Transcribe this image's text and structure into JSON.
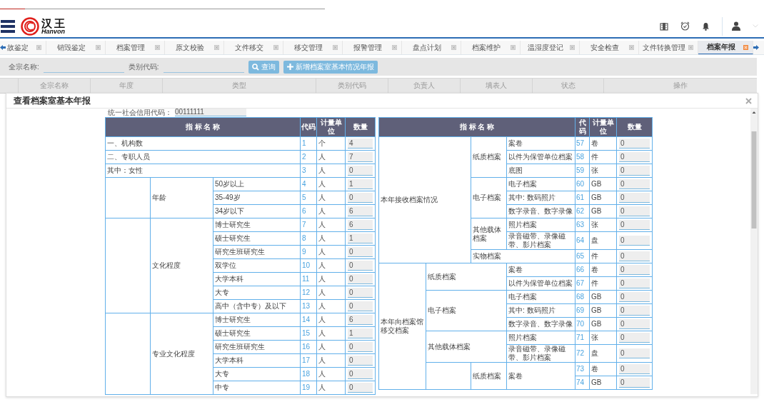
{
  "header": {
    "logo_cn": "汉王",
    "logo_en": "Hanvon"
  },
  "tabs": [
    {
      "label": "故鉴定",
      "selected": false
    },
    {
      "label": "销毁鉴定",
      "selected": false
    },
    {
      "label": "档案管理",
      "selected": false
    },
    {
      "label": "原文校验",
      "selected": false
    },
    {
      "label": "文件移交",
      "selected": false
    },
    {
      "label": "移交管理",
      "selected": false
    },
    {
      "label": "报警管理",
      "selected": false
    },
    {
      "label": "盘点计划",
      "selected": false
    },
    {
      "label": "档案维护",
      "selected": false
    },
    {
      "label": "温湿度登记",
      "selected": false
    },
    {
      "label": "安全检查",
      "selected": false
    },
    {
      "label": "文件转换管理",
      "selected": false
    },
    {
      "label": "档案年报",
      "selected": true
    }
  ],
  "search": {
    "fields": [
      {
        "label": "全宗名称:"
      },
      {
        "label": "类别代码:"
      }
    ],
    "buttons": [
      {
        "label": "查询",
        "kind": "search"
      },
      {
        "label": "新增档案室基本情况年报",
        "kind": "add"
      }
    ]
  },
  "grid": {
    "columns": [
      "全宗名称",
      "年度",
      "类型",
      "类别代码",
      "负责人",
      "填表人",
      "状态",
      "操作"
    ]
  },
  "dialog": {
    "title": "查看档案室基本年报",
    "credit_label": "统一社会信用代码：",
    "credit_value": "00111111",
    "tables": [
      {
        "headers": {
          "name": "指 标 名 称",
          "code": "代码",
          "unit": "计量单位",
          "quantity": "数量"
        },
        "rows": [
          {
            "label": "一、机构数",
            "code": "1",
            "unit": "个",
            "value": "4"
          },
          {
            "label": "二、专职人员",
            "code": "2",
            "unit": "人",
            "value": "7"
          },
          {
            "label": "其中：女性",
            "code": "3",
            "unit": "人",
            "value": "0"
          },
          {
            "children": [
              {
                "label": "年龄",
                "children": [
                  {
                    "label": "50岁以上",
                    "code": "4",
                    "unit": "人",
                    "value": "1"
                  },
                  {
                    "label": "35-49岁",
                    "code": "5",
                    "unit": "人",
                    "value": "0"
                  },
                  {
                    "label": "34岁以下",
                    "code": "6",
                    "unit": "人",
                    "value": "6"
                  }
                ]
              }
            ]
          },
          {
            "children": [
              {
                "label": "文化程度",
                "children": [
                  {
                    "label": "博士研究生",
                    "code": "7",
                    "unit": "人",
                    "value": "6"
                  },
                  {
                    "label": "硕士研究生",
                    "code": "8",
                    "unit": "人",
                    "value": "1"
                  },
                  {
                    "label": "研究生班研究生",
                    "code": "9",
                    "unit": "人",
                    "value": "0"
                  },
                  {
                    "label": "双学位",
                    "code": "10",
                    "unit": "人",
                    "value": "0"
                  },
                  {
                    "label": "大学本科",
                    "code": "11",
                    "unit": "人",
                    "value": "0"
                  },
                  {
                    "label": "大专",
                    "code": "12",
                    "unit": "人",
                    "value": "0"
                  },
                  {
                    "label": "高中（含中专）及以下",
                    "code": "13",
                    "unit": "人",
                    "value": "0"
                  }
                ]
              }
            ]
          },
          {
            "children": [
              {
                "label": "专业文化程度",
                "children": [
                  {
                    "label": "博士研究生",
                    "code": "14",
                    "unit": "人",
                    "value": "6"
                  },
                  {
                    "label": "硕士研究生",
                    "code": "15",
                    "unit": "人",
                    "value": "1"
                  },
                  {
                    "label": "研究生班研究生",
                    "code": "16",
                    "unit": "人",
                    "value": "0"
                  },
                  {
                    "label": "大学本科",
                    "code": "17",
                    "unit": "人",
                    "value": "0"
                  },
                  {
                    "label": "大专",
                    "code": "18",
                    "unit": "人",
                    "value": "0"
                  },
                  {
                    "label": "中专",
                    "code": "19",
                    "unit": "人",
                    "value": "0"
                  }
                ]
              }
            ]
          }
        ]
      },
      {
        "headers": {
          "name": "指 标 名 称",
          "code": "代码",
          "unit": "计量单位",
          "quantity": "数量"
        },
        "rows": [
          {
            "label": "本年接收档案情况",
            "children": [
              {
                "label": "纸质档案",
                "children": [
                  {
                    "label": "案卷",
                    "code": "57",
                    "unit": "卷",
                    "value": "0"
                  },
                  {
                    "label": "以件为保管单位档案",
                    "code": "58",
                    "unit": "件",
                    "value": "0"
                  },
                  {
                    "label": "底图",
                    "code": "59",
                    "unit": "张",
                    "value": "0"
                  }
                ]
              },
              {
                "label": "电子档案",
                "children": [
                  {
                    "label": "电子档案",
                    "code": "60",
                    "unit": "GB",
                    "value": "0"
                  },
                  {
                    "label": "其中: 数码照片",
                    "code": "61",
                    "unit": "GB",
                    "value": "0"
                  },
                  {
                    "label": "数字录音、数字录像",
                    "code": "62",
                    "unit": "GB",
                    "value": "0"
                  }
                ]
              },
              {
                "label": "其他载体档案",
                "children": [
                  {
                    "label": "照片档案",
                    "code": "63",
                    "unit": "张",
                    "value": "0"
                  },
                  {
                    "label": "录音磁带、录像磁带、影片档案",
                    "code": "64",
                    "unit": "盘",
                    "value": "0"
                  }
                ]
              },
              {
                "label": "实物档案",
                "code": "65",
                "unit": "件",
                "value": "0"
              }
            ]
          },
          {
            "label": "本年向档案馆移交档案",
            "children": [
              {
                "label": "纸质档案",
                "children": [
                  {
                    "label": "案卷",
                    "code": "66",
                    "unit": "卷",
                    "value": "0"
                  },
                  {
                    "label": "以件为保管单位档案",
                    "code": "67",
                    "unit": "件",
                    "value": "0"
                  }
                ]
              },
              {
                "label": "电子档案",
                "children": [
                  {
                    "label": "电子档案",
                    "code": "68",
                    "unit": "GB",
                    "value": "0"
                  },
                  {
                    "label": "其中: 数码照片",
                    "code": "69",
                    "unit": "GB",
                    "value": "0"
                  },
                  {
                    "label": "数字录音、数字录像",
                    "code": "70",
                    "unit": "GB",
                    "value": "0"
                  }
                ]
              },
              {
                "label": "其他载体档案",
                "children": [
                  {
                    "label": "照片档案",
                    "code": "71",
                    "unit": "张",
                    "value": "0"
                  },
                  {
                    "label": "录音磁带、录像磁带、影片档案",
                    "code": "72",
                    "unit": "盘",
                    "value": "0"
                  }
                ]
              },
              {
                "children": [
                  {
                    "label": "纸质档案",
                    "children": [
                      {
                        "label": "案卷",
                        "children": [
                          {
                            "code": "73",
                            "unit": "卷",
                            "value": "0"
                          },
                          {
                            "code": "74",
                            "unit": "GB",
                            "value": "0"
                          }
                        ]
                      }
                    ]
                  }
                ]
              }
            ]
          }
        ]
      }
    ]
  }
}
